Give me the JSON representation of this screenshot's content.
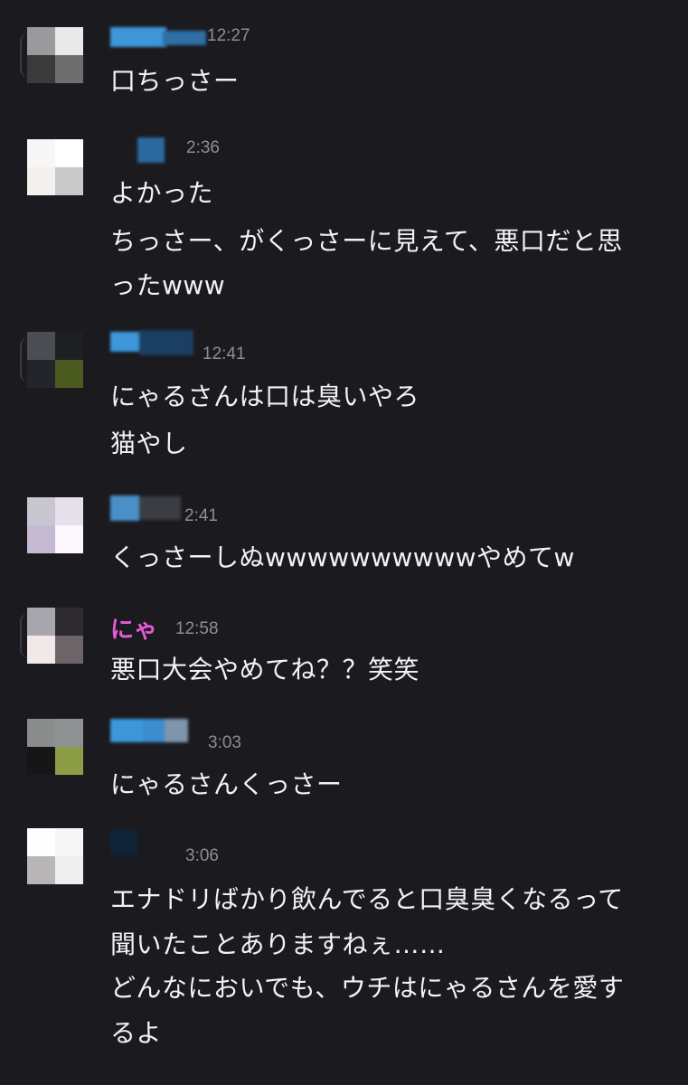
{
  "colors": {
    "background": "#1b1a1f",
    "text": "#f3f3f5",
    "timestamp": "#8e8d96",
    "highlight_name": "#e35bd5",
    "redacted_blue": "#3d97d8"
  },
  "messages": [
    {
      "time": "12:27",
      "avatar": [
        "#9a9a9c",
        "#e9e9e9",
        "#3a3a3a",
        "#6e6e6e"
      ],
      "lines": [
        "口ちっさー"
      ]
    },
    {
      "time": "2:36",
      "avatar": [
        "#f7f7f7",
        "#ffffff",
        "#f4f0ee",
        "#c9c9c9"
      ],
      "lines": [
        "よかった",
        "ちっさー、がくっさーに見えて、悪口だと思",
        "ったwww"
      ]
    },
    {
      "time": "12:41",
      "avatar": [
        "#4a4d52",
        "#1d2022",
        "#23252a",
        "#4b5a1e"
      ],
      "lines": [
        "にゃるさんは口は臭いやろ",
        "猫やし"
      ]
    },
    {
      "time": "2:41",
      "avatar": [
        "#c8c6d0",
        "#e6e0ec",
        "#c6bad3",
        "#fbf7fd"
      ],
      "lines": [
        "くっさーしぬwwwwwwwwwwやめてw"
      ]
    },
    {
      "name": "にゃ",
      "time": "12:58",
      "avatar": [
        "#a8a6ad",
        "#2d2b30",
        "#f1e8ea",
        "#6d6468"
      ],
      "lines": [
        "悪口大会やめてね？？笑笑"
      ]
    },
    {
      "time": "3:03",
      "avatar": [
        "#8b8d8d",
        "#8e9191",
        "#161616",
        "#8c9d45"
      ],
      "lines": [
        "にゃるさんくっさー"
      ]
    },
    {
      "time": "3:06",
      "avatar": [
        "#fefefe",
        "#f6f6f6",
        "#b8b6b6",
        "#efefef"
      ],
      "lines": [
        "エナドリばかり飲んでると口臭臭くなるって",
        "聞いたことありますねぇ……",
        "どんなにおいでも、ウチはにゃるさんを愛す",
        "るよ"
      ]
    }
  ]
}
